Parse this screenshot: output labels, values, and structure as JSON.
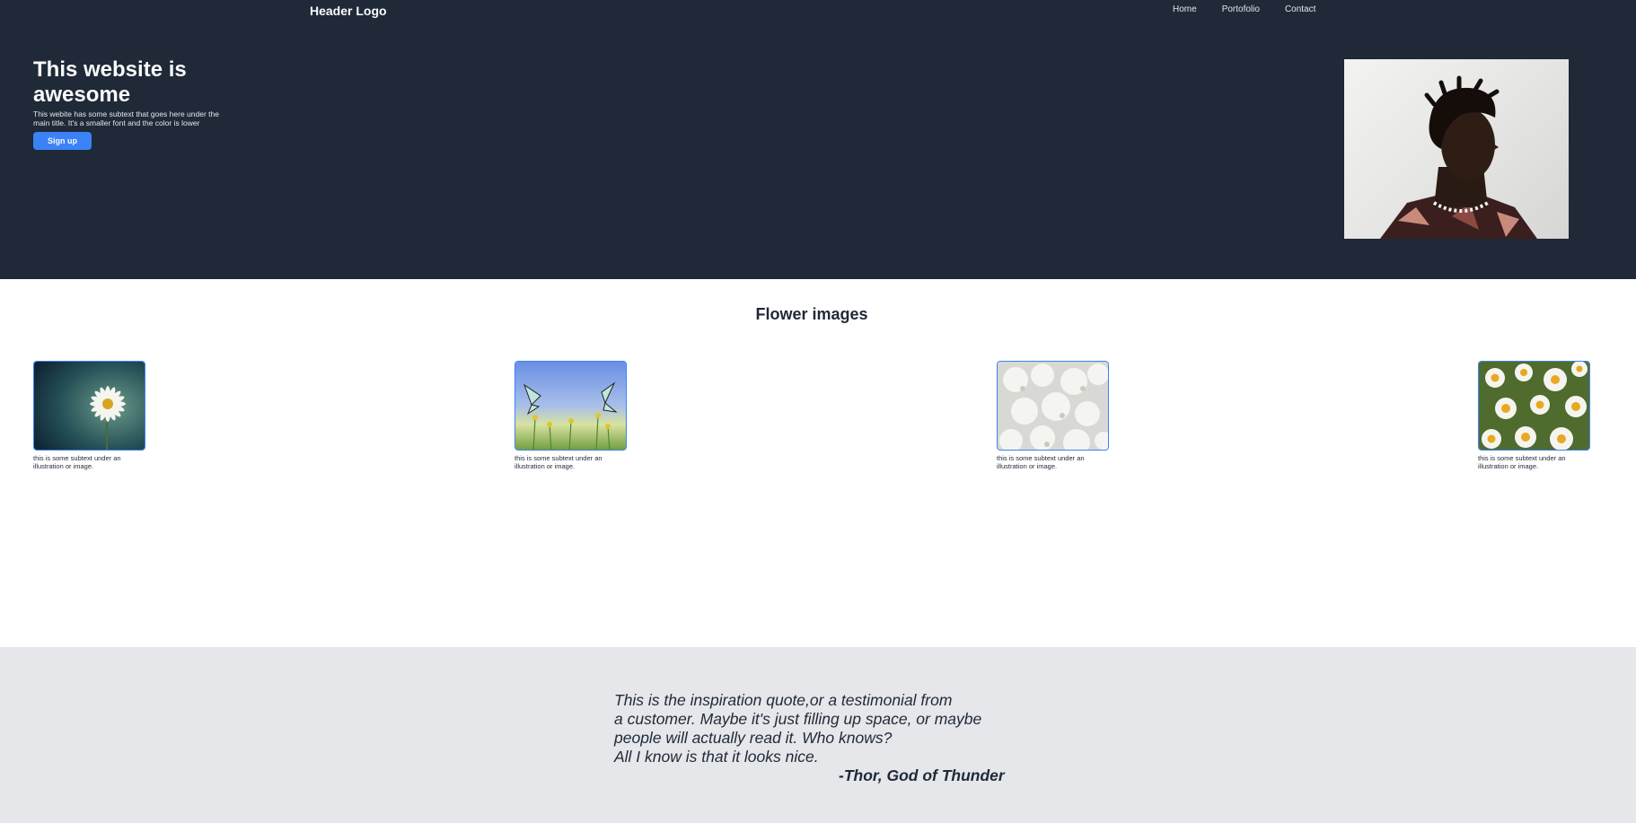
{
  "header": {
    "logo": "Header Logo",
    "nav": [
      "Home",
      "Portofolio",
      "Contact"
    ]
  },
  "hero": {
    "title": "This website is awesome",
    "subtext": "This webite has some subtext that goes here under the main title. It's a smaller font and the color is lower",
    "signup_label": "Sign up"
  },
  "flowers": {
    "title": "Flower images",
    "items": [
      {
        "caption": "this is some subtext under an illustration or image.",
        "image": "white daisy on dark teal background"
      },
      {
        "caption": "this is some subtext under an illustration or image.",
        "image": "butterflies on meadow flowers"
      },
      {
        "caption": "this is some subtext under an illustration or image.",
        "image": "white lilac blossoms"
      },
      {
        "caption": "this is some subtext under an illustration or image.",
        "image": "field of chamomile daisies"
      }
    ]
  },
  "quote": {
    "lines": [
      "This is the inspiration quote,or a testimonial from",
      "a customer. Maybe it's just filling up space, or maybe",
      "people will actually read it. Who knows?",
      "All I know is that it looks nice."
    ],
    "author": "-Thor, God of Thunder"
  },
  "colors": {
    "hero_bg": "#1f2937",
    "accent": "#3b82f6",
    "quote_bg": "#e5e7eb",
    "text_dark": "#1f2937"
  }
}
